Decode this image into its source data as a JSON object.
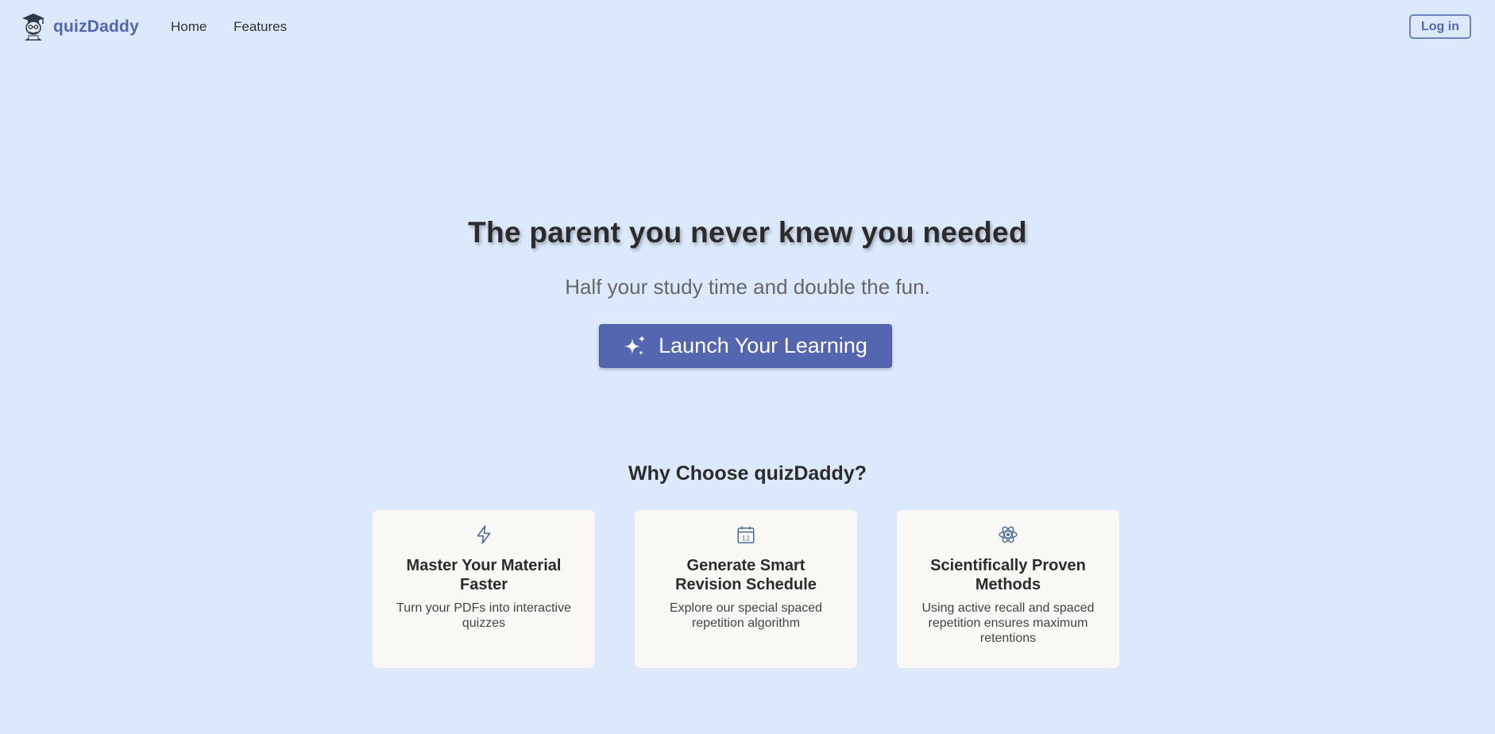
{
  "nav": {
    "brand": "quizDaddy",
    "links": [
      {
        "label": "Home"
      },
      {
        "label": "Features"
      }
    ],
    "login_label": "Log in"
  },
  "hero": {
    "title": "The parent you never knew you needed",
    "subtitle": "Half your study time and double the fun.",
    "cta_label": "Launch Your Learning",
    "cta_icon": "sparkles-icon"
  },
  "features": {
    "heading": "Why Choose quizDaddy?",
    "cards": [
      {
        "icon": "lightning-icon",
        "title": "Master Your Material Faster",
        "text": "Turn your PDFs into interactive quizzes"
      },
      {
        "icon": "calendar-icon",
        "icon_text": "12",
        "title": "Generate Smart Revision Schedule",
        "text": "Explore our special spaced repetition algorithm"
      },
      {
        "icon": "atom-icon",
        "title": "Scientifically Proven Methods",
        "text": "Using active recall and spaced repetition ensures maximum retentions"
      }
    ]
  },
  "colors": {
    "background": "#dce9fd",
    "accent": "#5566b0",
    "card_bg": "#faf8f5",
    "icon": "#4a6e9a"
  }
}
